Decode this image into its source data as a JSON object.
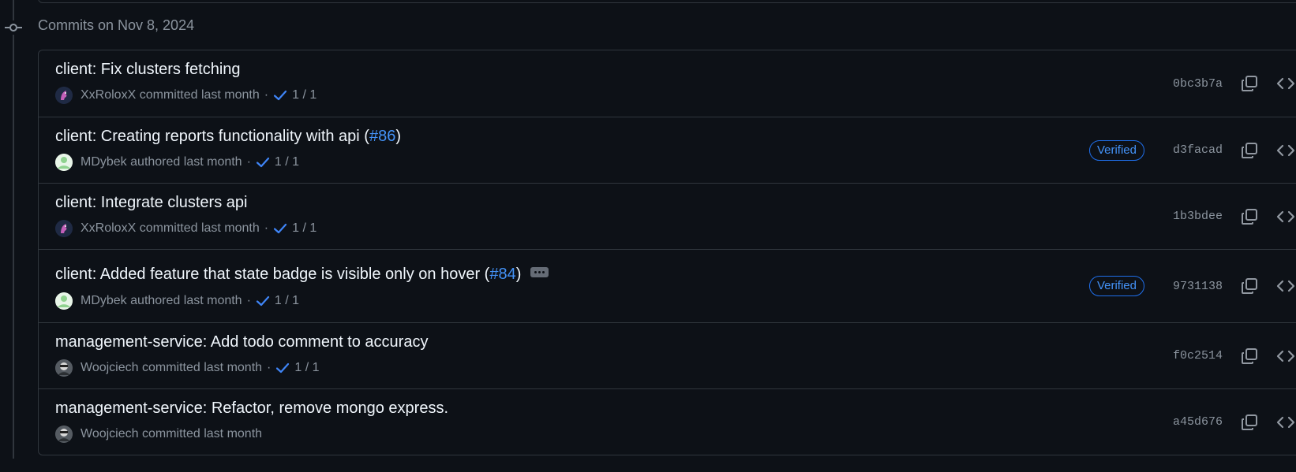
{
  "group": {
    "header": "Commits on Nov 8, 2024"
  },
  "commits": [
    {
      "title": "client: Fix clusters fetching",
      "pr_open": "",
      "pr": "",
      "pr_close": "",
      "author": "XxRoloxX",
      "action": "committed",
      "time": "last month",
      "checks": "1 / 1",
      "verified": "",
      "sha": "0bc3b7a"
    },
    {
      "title": "client: Creating reports functionality with api (",
      "pr_open": "",
      "pr": "#86",
      "pr_close": ")",
      "author": "MDybek",
      "action": "authored",
      "time": "last month",
      "checks": "1 / 1",
      "verified": "Verified",
      "sha": "d3facad"
    },
    {
      "title": "client: Integrate clusters api",
      "pr_open": "",
      "pr": "",
      "pr_close": "",
      "author": "XxRoloxX",
      "action": "committed",
      "time": "last month",
      "checks": "1 / 1",
      "verified": "",
      "sha": "1b3bdee"
    },
    {
      "title": "client: Added feature that state badge is visible only on hover (",
      "pr_open": "",
      "pr": "#84",
      "pr_close": ")",
      "author": "MDybek",
      "action": "authored",
      "time": "last month",
      "checks": "1 / 1",
      "verified": "Verified",
      "sha": "9731138"
    },
    {
      "title": "management-service: Add todo comment to accuracy",
      "pr_open": "",
      "pr": "",
      "pr_close": "",
      "author": "Woojciech",
      "action": "committed",
      "time": "last month",
      "checks": "1 / 1",
      "verified": "",
      "sha": "f0c2514"
    },
    {
      "title": "management-service: Refactor, remove mongo express.",
      "pr_open": "",
      "pr": "",
      "pr_close": "",
      "author": "Woojciech",
      "action": "committed",
      "time": "last month",
      "checks": "",
      "verified": "",
      "sha": "a45d676"
    }
  ],
  "icons": {
    "node": "git-commit-icon",
    "check": "check-icon",
    "copy": "copy-icon",
    "browse": "code-icon",
    "more": "ellipsis-icon"
  },
  "colors": {
    "background": "#0d1117",
    "border": "#30363d",
    "link": "#4493f8",
    "muted": "#8b949e",
    "check": "#3f85f7"
  }
}
